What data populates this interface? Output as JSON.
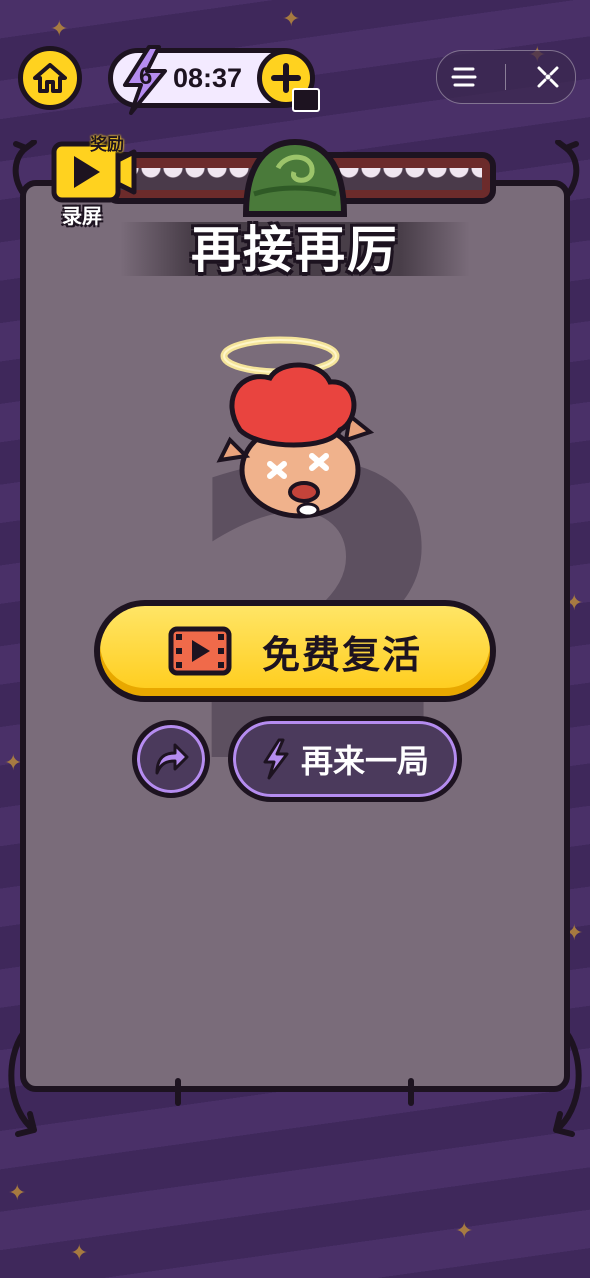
{
  "topbar": {
    "energy_count": "6",
    "energy_timer": "08:37"
  },
  "reward": {
    "badge_top": "奖励",
    "badge_bottom": "录屏"
  },
  "result": {
    "title": "再接再厉",
    "rank_number": "2"
  },
  "actions": {
    "revive_label": "免费复活",
    "play_again_label": "再来一局"
  },
  "icons": {
    "home": "home-icon",
    "energy": "lightning-bolt-icon",
    "add": "plus-icon",
    "menu": "menu-icon",
    "close": "close-icon",
    "video": "video-icon",
    "share": "share-arrow-icon"
  },
  "colors": {
    "accent_yellow": "#ffd21f",
    "accent_purple": "#b58cf0",
    "panel": "#7a6c7a",
    "outline": "#1d1320"
  }
}
